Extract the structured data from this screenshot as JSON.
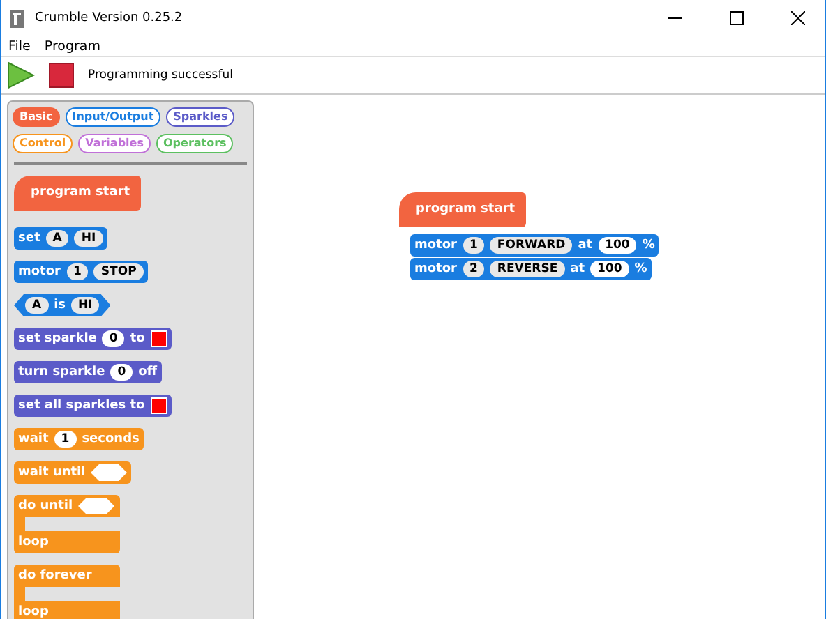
{
  "window": {
    "title": "Crumble Version 0.25.2"
  },
  "menu": [
    "File",
    "Program"
  ],
  "toolbar": {
    "status": "Programming successful"
  },
  "palette": {
    "categories": [
      {
        "label": "Basic",
        "color": "#f26440",
        "selected": true
      },
      {
        "label": "Input/Output",
        "color": "#1a7de0",
        "selected": false
      },
      {
        "label": "Sparkles",
        "color": "#5b5bc8",
        "selected": false
      },
      {
        "label": "Control",
        "color": "#f7941d",
        "selected": false
      },
      {
        "label": "Variables",
        "color": "#c070d8",
        "selected": false
      },
      {
        "label": "Operators",
        "color": "#5cc060",
        "selected": false
      }
    ],
    "blocks": [
      {
        "kind": "hat",
        "color": "#f26440",
        "parts": [
          {
            "kind": "label",
            "text": "program start"
          }
        ]
      },
      {
        "kind": "command",
        "color": "#1a7de0",
        "parts": [
          {
            "kind": "label",
            "text": "set"
          },
          {
            "kind": "menu",
            "text": "A"
          },
          {
            "kind": "menu",
            "text": "HI"
          }
        ]
      },
      {
        "kind": "command",
        "color": "#1a7de0",
        "parts": [
          {
            "kind": "label",
            "text": "motor"
          },
          {
            "kind": "menu",
            "text": "1"
          },
          {
            "kind": "menu",
            "text": "STOP"
          }
        ]
      },
      {
        "kind": "boolean",
        "color": "#1a7de0",
        "parts": [
          {
            "kind": "menu",
            "text": "A"
          },
          {
            "kind": "label",
            "text": "is"
          },
          {
            "kind": "menu",
            "text": "HI"
          }
        ]
      },
      {
        "kind": "command",
        "color": "#5b5bc8",
        "parts": [
          {
            "kind": "label",
            "text": "set sparkle"
          },
          {
            "kind": "num",
            "text": "0"
          },
          {
            "kind": "label",
            "text": "to"
          },
          {
            "kind": "color",
            "color": "#ff0000"
          }
        ]
      },
      {
        "kind": "command",
        "color": "#5b5bc8",
        "parts": [
          {
            "kind": "label",
            "text": "turn sparkle"
          },
          {
            "kind": "num",
            "text": "0"
          },
          {
            "kind": "label",
            "text": "off"
          }
        ]
      },
      {
        "kind": "command",
        "color": "#5b5bc8",
        "parts": [
          {
            "kind": "label",
            "text": "set all sparkles to"
          },
          {
            "kind": "color",
            "color": "#ff0000"
          }
        ]
      },
      {
        "kind": "command",
        "color": "#f7941d",
        "parts": [
          {
            "kind": "label",
            "text": "wait"
          },
          {
            "kind": "num",
            "text": "1"
          },
          {
            "kind": "label",
            "text": "seconds"
          }
        ]
      },
      {
        "kind": "command",
        "color": "#f7941d",
        "parts": [
          {
            "kind": "label",
            "text": "wait until"
          },
          {
            "kind": "hex"
          }
        ]
      },
      {
        "kind": "c",
        "color": "#f7941d",
        "parts": [
          {
            "kind": "label",
            "text": "do until"
          },
          {
            "kind": "hex"
          }
        ],
        "end_label": "loop"
      },
      {
        "kind": "c",
        "color": "#f7941d",
        "parts": [
          {
            "kind": "label",
            "text": "do forever"
          }
        ],
        "end_label": "loop"
      }
    ]
  },
  "script": [
    {
      "kind": "hat",
      "color": "#f26440",
      "parts": [
        {
          "kind": "label",
          "text": "program start"
        }
      ]
    },
    {
      "kind": "command",
      "color": "#1a7de0",
      "parts": [
        {
          "kind": "label",
          "text": "motor"
        },
        {
          "kind": "menu",
          "text": "1"
        },
        {
          "kind": "menu",
          "text": "FORWARD"
        },
        {
          "kind": "label",
          "text": "at"
        },
        {
          "kind": "num",
          "text": "100"
        },
        {
          "kind": "label",
          "text": "%"
        }
      ]
    },
    {
      "kind": "command",
      "color": "#1a7de0",
      "parts": [
        {
          "kind": "label",
          "text": "motor"
        },
        {
          "kind": "menu",
          "text": "2"
        },
        {
          "kind": "menu",
          "text": "REVERSE"
        },
        {
          "kind": "label",
          "text": "at"
        },
        {
          "kind": "num",
          "text": "100"
        },
        {
          "kind": "label",
          "text": "%"
        }
      ]
    }
  ]
}
